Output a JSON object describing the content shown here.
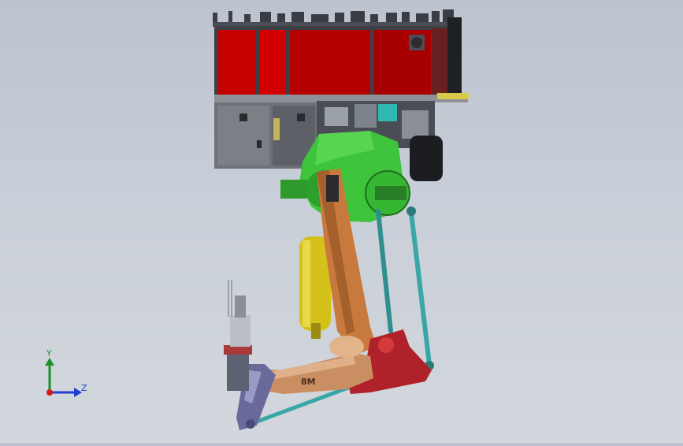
{
  "viewport": {
    "background_top": "#bcc3cf",
    "background_bottom": "#d3d7dd"
  },
  "model": {
    "colors": {
      "cabinet_red": "#c40000",
      "cabinet_dark": "#5a5a5e",
      "gearbox_green": "#3ec43a",
      "arm_orange": "#c87a3e",
      "cylinder_yellow": "#d4c21a",
      "link_teal": "#3aa6a6",
      "bracket_red": "#b0222a",
      "lower_arm_tan": "#c98f62",
      "head_purple": "#6a6a9a"
    },
    "label": "8M"
  },
  "triad": {
    "y_label": "Y",
    "z_label": "Z",
    "y_color": "#1a8f2a",
    "z_color": "#1f3fd0",
    "x_color": "#d11a1a",
    "icon": "coordinate-triad-icon"
  }
}
